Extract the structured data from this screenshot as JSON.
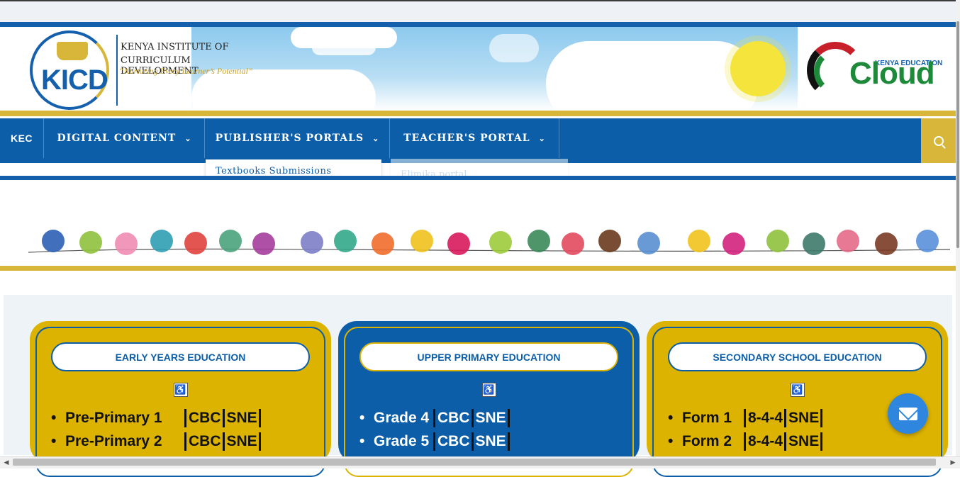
{
  "header": {
    "org_line1": "KENYA INSTITUTE OF",
    "org_line2": "CURRICULUM DEVELOPMENT",
    "motto": "“Nurturing Every Learner’s Potential”",
    "kicd_abbr": "KICD",
    "cloud_top": "KENYA EDUCATION",
    "cloud_word": "Cloud"
  },
  "nav": {
    "items": [
      {
        "label": "KEC",
        "has_dropdown": false
      },
      {
        "label": "DIGITAL CONTENT",
        "has_dropdown": true
      },
      {
        "label": "PUBLISHER'S PORTALS",
        "has_dropdown": true
      },
      {
        "label": "TEACHER'S PORTAL",
        "has_dropdown": true
      }
    ],
    "search_icon": "search-icon",
    "chevron": "⌄"
  },
  "dropdowns": {
    "publisher": {
      "item": "Textbooks Submissions"
    },
    "teacher": {
      "item": "Elimika portal"
    }
  },
  "cards": [
    {
      "title": "EARLY YEARS EDUCATION",
      "theme": "gold",
      "rows": [
        {
          "name": "Pre-Primary 1",
          "tags": [
            "CBC",
            "SNE"
          ]
        },
        {
          "name": "Pre-Primary 2",
          "tags": [
            "CBC",
            "SNE"
          ]
        }
      ]
    },
    {
      "title": "UPPER PRIMARY EDUCATION",
      "theme": "blue",
      "rows": [
        {
          "name": "Grade 4",
          "tags": [
            "CBC",
            "SNE"
          ]
        },
        {
          "name": "Grade 5",
          "tags": [
            "CBC",
            "SNE"
          ]
        }
      ]
    },
    {
      "title": "SECONDARY SCHOOL EDUCATION",
      "theme": "gold",
      "rows": [
        {
          "name": "Form 1",
          "tags": [
            "8-4-4",
            "SNE"
          ]
        },
        {
          "name": "Form 2",
          "tags": [
            "8-4-4",
            "SNE"
          ]
        }
      ]
    }
  ],
  "accessibility_icon": "wheelchair-icon",
  "chat_icon": "envelope-icon",
  "colors": {
    "brand_blue": "#0c5ea9",
    "brand_gold": "#dcb300",
    "chat_blue": "#2e86de"
  }
}
